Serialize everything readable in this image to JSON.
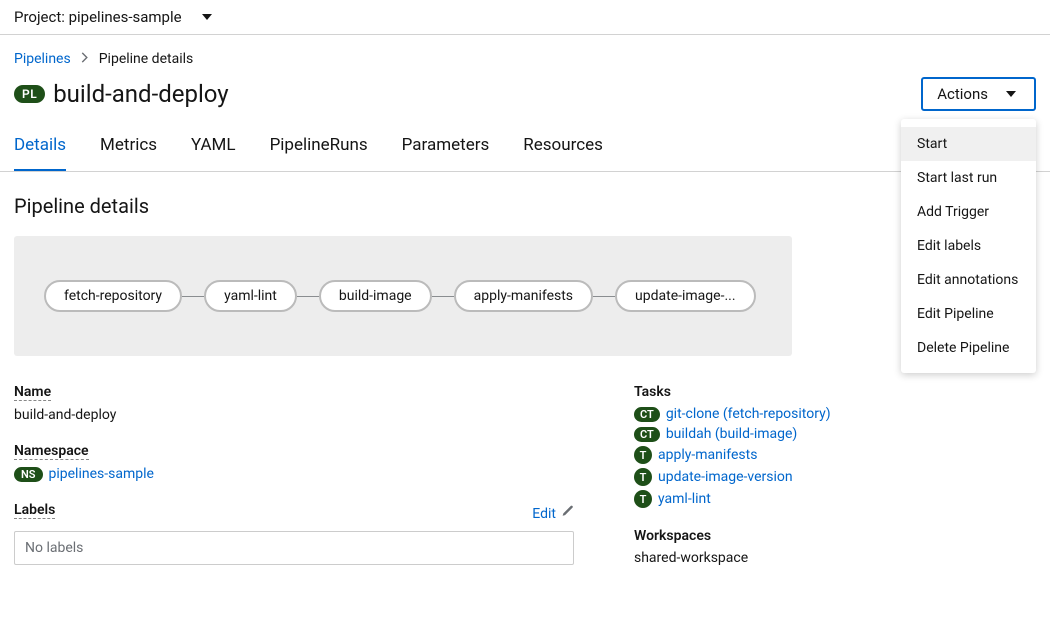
{
  "project": {
    "label": "Project: pipelines-sample"
  },
  "breadcrumb": {
    "root": "Pipelines",
    "current": "Pipeline details"
  },
  "header": {
    "badge": "PL",
    "title": "build-and-deploy",
    "actions_label": "Actions"
  },
  "actions_menu": {
    "start": "Start",
    "start_last": "Start last run",
    "add_trigger": "Add Trigger",
    "edit_labels": "Edit labels",
    "edit_annotations": "Edit annotations",
    "edit_pipeline": "Edit Pipeline",
    "delete_pipeline": "Delete Pipeline"
  },
  "tabs": {
    "details": "Details",
    "metrics": "Metrics",
    "yaml": "YAML",
    "pipelineruns": "PipelineRuns",
    "parameters": "Parameters",
    "resources": "Resources"
  },
  "section_title": "Pipeline details",
  "pipeline_nodes": {
    "n0": "fetch-repository",
    "n1": "yaml-lint",
    "n2": "build-image",
    "n3": "apply-manifests",
    "n4": "update-image-..."
  },
  "fields": {
    "name_label": "Name",
    "name_value": "build-and-deploy",
    "namespace_label": "Namespace",
    "namespace_badge": "NS",
    "namespace_value": "pipelines-sample",
    "labels_label": "Labels",
    "edit_label": "Edit",
    "no_labels": "No labels",
    "tasks_label": "Tasks",
    "workspaces_label": "Workspaces",
    "workspace_value": "shared-workspace"
  },
  "badges": {
    "ct": "CT",
    "t": "T"
  },
  "tasks": {
    "t0": "git-clone (fetch-repository)",
    "t1": "buildah (build-image)",
    "t2": "apply-manifests",
    "t3": "update-image-version",
    "t4": "yaml-lint"
  }
}
